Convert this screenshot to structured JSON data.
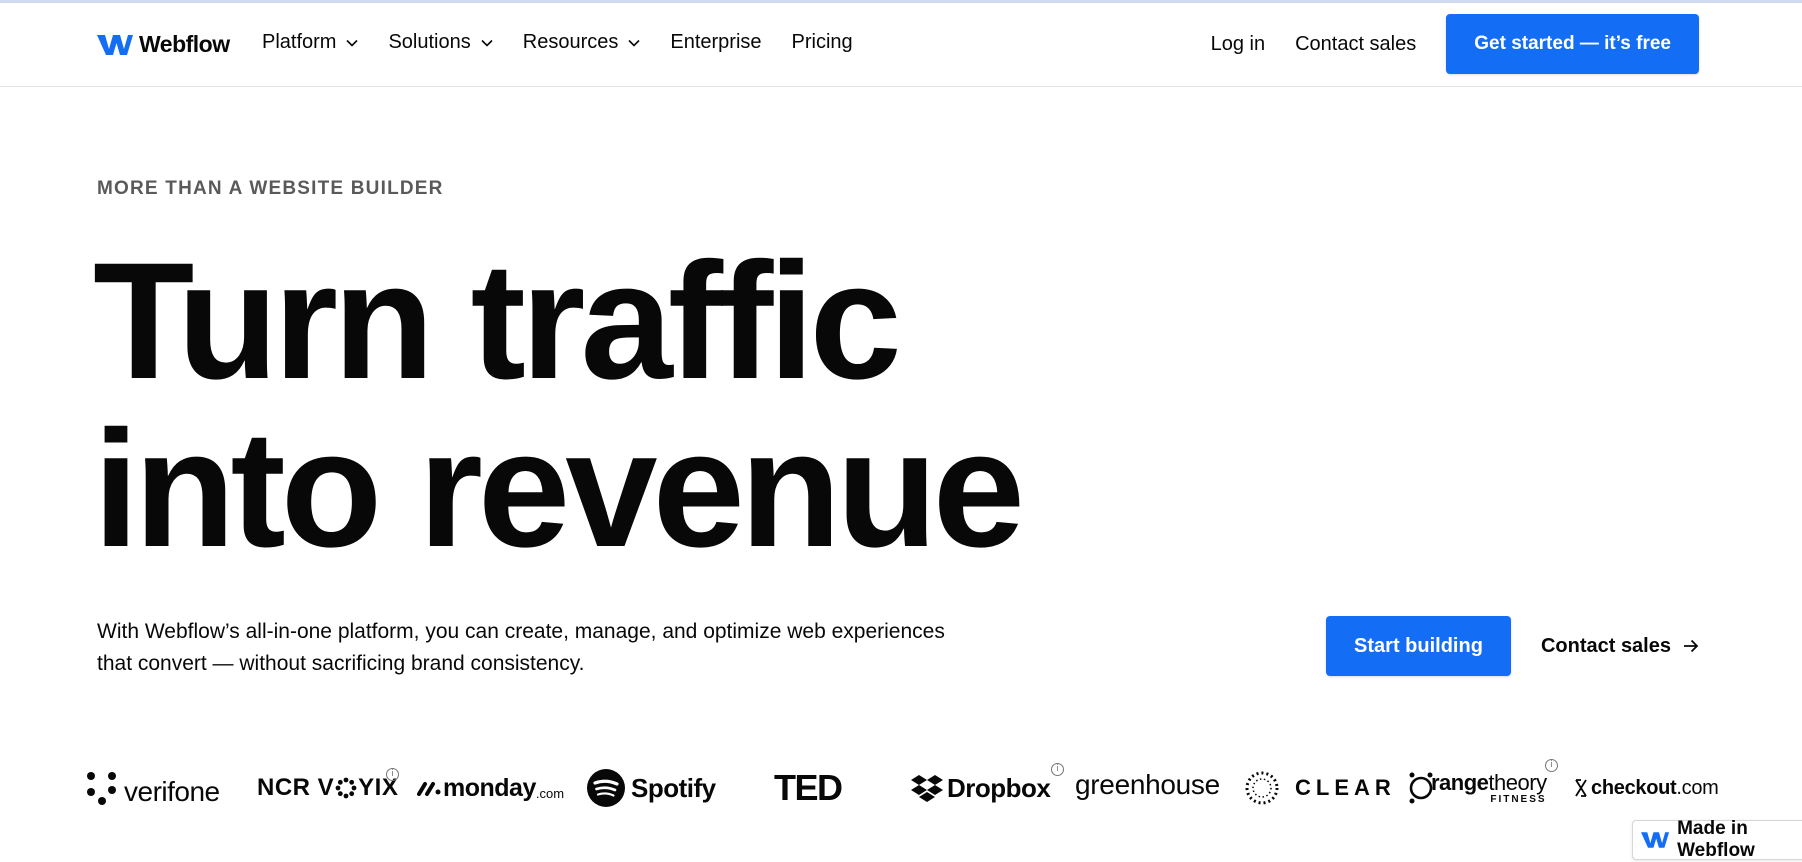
{
  "brand": {
    "name": "Webflow",
    "accent": "#146ef5"
  },
  "nav": {
    "items": [
      {
        "label": "Platform",
        "has_dropdown": true
      },
      {
        "label": "Solutions",
        "has_dropdown": true
      },
      {
        "label": "Resources",
        "has_dropdown": true
      },
      {
        "label": "Enterprise",
        "has_dropdown": false
      },
      {
        "label": "Pricing",
        "has_dropdown": false
      }
    ],
    "login": "Log in",
    "contact": "Contact sales",
    "cta": "Get started — it’s free"
  },
  "hero": {
    "eyebrow": "MORE THAN A WEBSITE BUILDER",
    "headline_line1": "Turn traffic",
    "headline_line2": "into revenue",
    "subtext": "With Webflow’s all-in-one platform, you can create, manage, and optimize web experiences that convert — without sacrificing brand consistency.",
    "cta_primary": "Start building",
    "cta_secondary": "Contact sales"
  },
  "customer_logos": {
    "verifone": "verifone",
    "ncr_a": "NCR V",
    "ncr_b": "YIX",
    "monday": "monday",
    "monday_suffix": ".com",
    "spotify": "Spotify",
    "ted": "TED",
    "dropbox": "Dropbox",
    "greenhouse": "greenhouse",
    "clear": "CLEAR",
    "orangetheory_a": "range",
    "orangetheory_b": "theory",
    "orangetheory_sub": "FITNESS",
    "checkout": "checkout",
    "checkout_suffix": ".com"
  },
  "badge": {
    "label": "Made in Webflow"
  }
}
